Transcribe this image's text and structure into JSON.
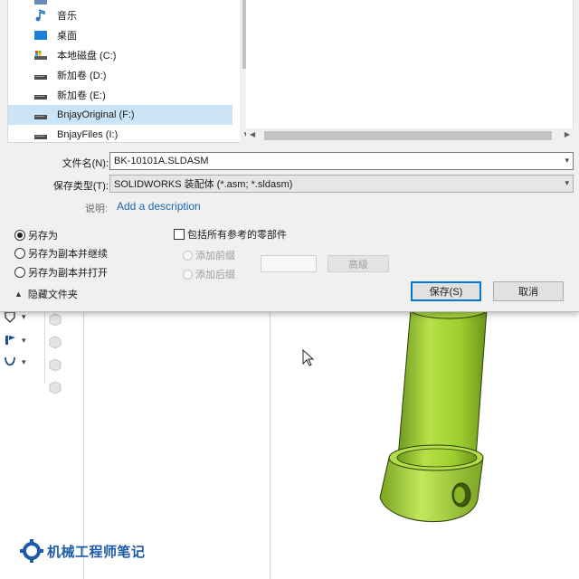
{
  "nav": {
    "items": [
      {
        "label": "音乐",
        "icon": "music-note-icon"
      },
      {
        "label": "桌面",
        "icon": "desktop-folder-icon"
      },
      {
        "label": "本地磁盘 (C:)",
        "icon": "system-drive-icon"
      },
      {
        "label": "新加卷 (D:)",
        "icon": "drive-icon"
      },
      {
        "label": "新加卷 (E:)",
        "icon": "drive-icon"
      },
      {
        "label": "BnjayOriginal (F:)",
        "icon": "drive-icon",
        "selected": true
      },
      {
        "label": "BnjayFiles (I:)",
        "icon": "drive-icon"
      }
    ]
  },
  "form": {
    "filename_label": "文件名(N):",
    "filename_value": "BK-10101A.SLDASM",
    "type_label": "保存类型(T):",
    "type_value": "SOLIDWORKS 装配体 (*.asm; *.sldasm)",
    "desc_label": "说明:",
    "desc_link": "Add a description"
  },
  "options": {
    "save_as": "另存为",
    "save_copy_continue": "另存为副本并继续",
    "save_copy_open": "另存为副本并打开",
    "include_refs": "包括所有参考的零部件",
    "add_prefix": "添加前缀",
    "add_suffix": "添加后缀",
    "advanced": "高级"
  },
  "footer": {
    "hide_folders": "隐藏文件夹",
    "save_button": "保存(S)",
    "cancel_button": "取消"
  },
  "watermark": "机械工程师笔记",
  "colors": {
    "part_green": "#9ccf2e",
    "selection": "#cce4f7",
    "link": "#1a64b0",
    "watermark": "#1d5aa8"
  }
}
